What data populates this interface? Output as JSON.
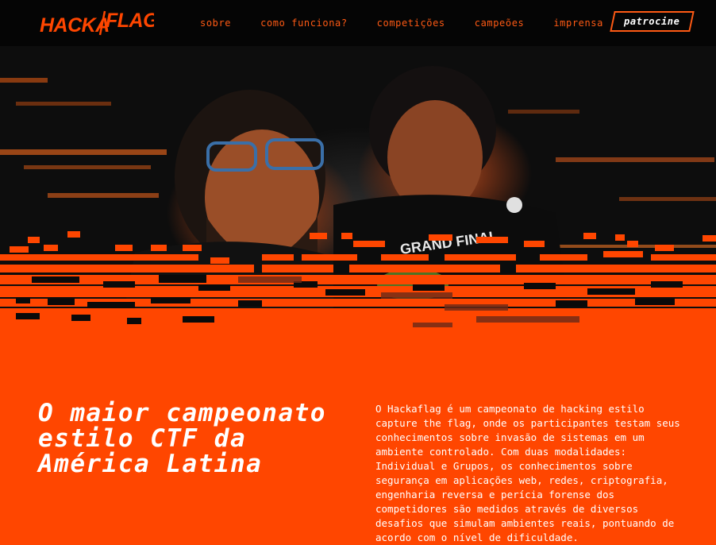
{
  "nav": {
    "logo_text": "HACKA/FLAG",
    "links": [
      "sobre",
      "como funciona?",
      "competições",
      "campeões",
      "imprensa"
    ],
    "sponsor_label": "patrocine"
  },
  "hero": {
    "shirt_text": "GRAND FINAL"
  },
  "main": {
    "headline_part1": "O ",
    "headline_bold": "maior campeonato estilo CTF",
    "headline_part2": " da América Latina",
    "description": "O Hackaflag é um campeonato de hacking estilo capture the flag, onde os participantes testam seus conhecimentos sobre invasão de sistemas em um ambiente controlado. Com duas modalidades: Individual e Grupos, os conhecimentos sobre segurança em aplicações web, redes, criptografia, engenharia reversa e perícia forense dos competidores são medidos através de diversos desafios que simulam ambientes reais, pontuando de acordo com o nível de dificuldade."
  },
  "colors": {
    "accent": "#ff4600",
    "nav_bg": "#050505",
    "link": "#ff5a14",
    "text": "#ffffff"
  }
}
